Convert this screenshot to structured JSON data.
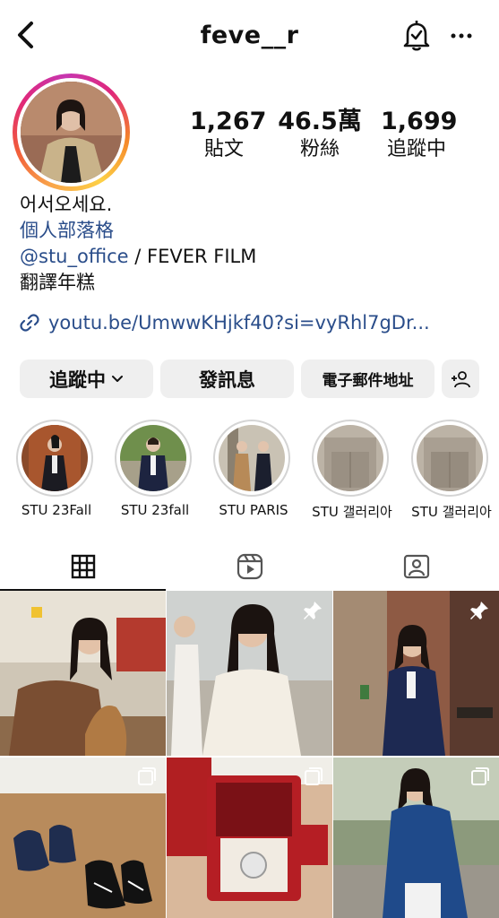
{
  "header": {
    "username": "feve__r",
    "back_icon": "chevron-left-icon",
    "bell_icon": "bell-check-icon",
    "more_icon": "more-horizontal-icon"
  },
  "profile": {
    "stats": [
      {
        "value": "1,267",
        "label": "貼文"
      },
      {
        "value": "46.5萬",
        "label": "粉絲"
      },
      {
        "value": "1,699",
        "label": "追蹤中"
      }
    ],
    "bio": {
      "name": "어서오세요.",
      "blog_link": "個人部落格",
      "mention": "@stu_office",
      "mention_suffix": " / FEVER FILM",
      "line4": "翻譯年糕"
    },
    "url": "youtu.be/UmwwKHjkf40?si=vyRhl7gDr..."
  },
  "actions": {
    "following": "追蹤中",
    "message": "發訊息",
    "email": "電子郵件地址",
    "add_person_icon": "add-person-icon"
  },
  "highlights": [
    {
      "label": "STU 23Fall"
    },
    {
      "label": "STU 23fall"
    },
    {
      "label": "STU PARIS"
    },
    {
      "label": "STU 갤러리아"
    },
    {
      "label": "STU 갤러리아"
    }
  ],
  "tabs": [
    {
      "name": "grid",
      "icon": "grid-icon"
    },
    {
      "name": "reels",
      "icon": "reels-icon"
    },
    {
      "name": "tagged",
      "icon": "tagged-person-icon"
    }
  ],
  "grid_posts": [
    {
      "type": "photo",
      "overlay": "none"
    },
    {
      "type": "photo",
      "overlay": "pin"
    },
    {
      "type": "photo",
      "overlay": "pin"
    },
    {
      "type": "photo",
      "overlay": "multi"
    },
    {
      "type": "photo",
      "overlay": "multi"
    },
    {
      "type": "photo",
      "overlay": "multi"
    }
  ]
}
